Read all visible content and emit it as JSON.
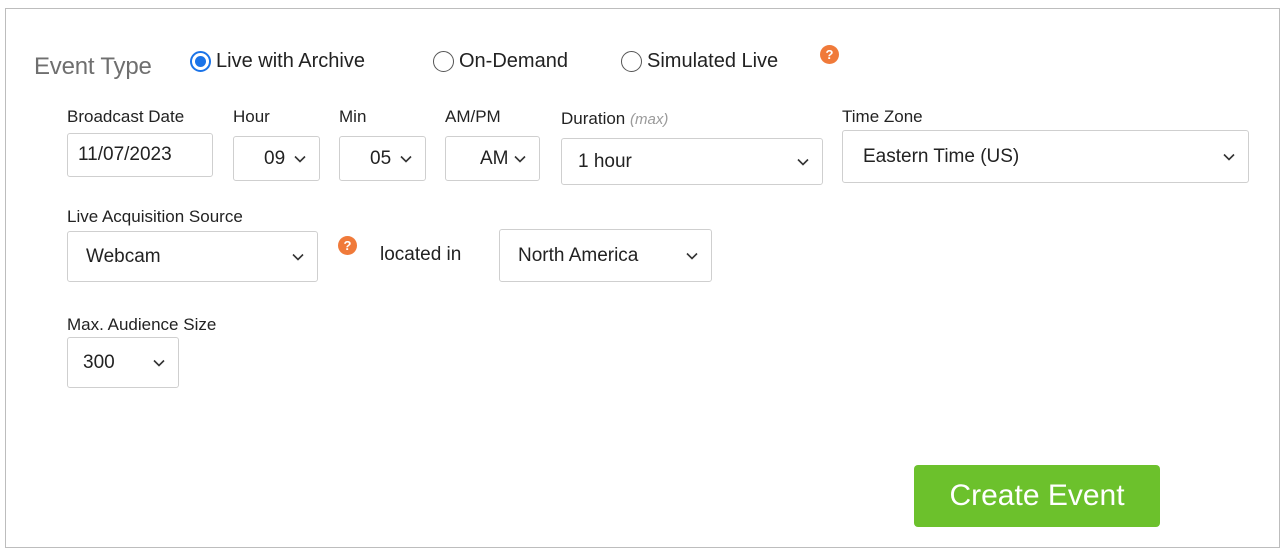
{
  "event_type": {
    "label": "Event Type",
    "options": [
      {
        "label": "Live with Archive",
        "checked": true
      },
      {
        "label": "On-Demand",
        "checked": false
      },
      {
        "label": "Simulated Live",
        "checked": false
      }
    ],
    "help_glyph": "?"
  },
  "schedule": {
    "broadcast_date": {
      "label": "Broadcast Date",
      "value": "11/07/2023"
    },
    "hour": {
      "label": "Hour",
      "value": "09"
    },
    "min": {
      "label": "Min",
      "value": "05"
    },
    "ampm": {
      "label": "AM/PM",
      "value": "AM"
    },
    "duration": {
      "label": "Duration",
      "hint": "(max)",
      "value": "1 hour"
    },
    "time_zone": {
      "label": "Time Zone",
      "value": "Eastern Time (US)"
    }
  },
  "acquisition": {
    "label": "Live Acquisition Source",
    "value": "Webcam",
    "help_glyph": "?",
    "located_in_label": "located in",
    "region": "North America"
  },
  "audience": {
    "label": "Max. Audience Size",
    "value": "300"
  },
  "actions": {
    "create_label": "Create Event"
  },
  "colors": {
    "accent": "#1a73e8",
    "help": "#f07a3a",
    "create_button": "#6cc12c"
  }
}
